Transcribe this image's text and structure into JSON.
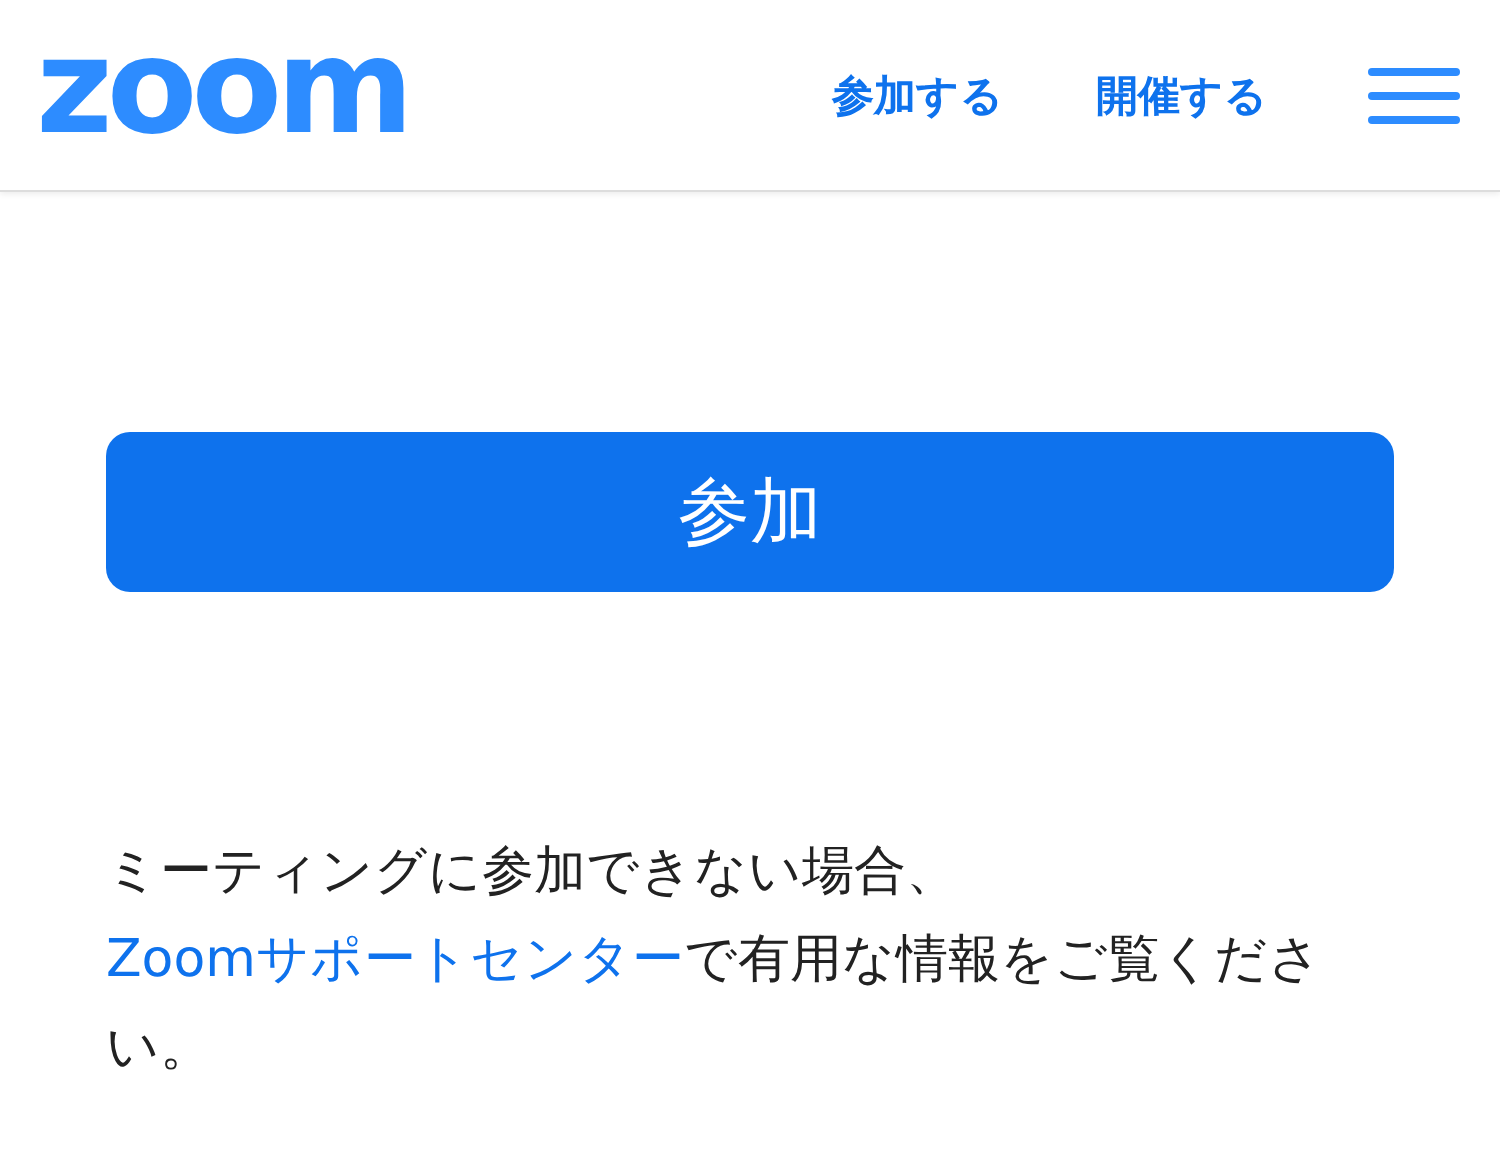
{
  "header": {
    "logo": "zoom",
    "nav": [
      "参加する",
      "開催する"
    ]
  },
  "join_button": "参加",
  "help": {
    "before": "ミーティングに参加できない場合、",
    "link": "Zoomサポートセンター",
    "after": "で有用な情報をご覧ください。"
  }
}
